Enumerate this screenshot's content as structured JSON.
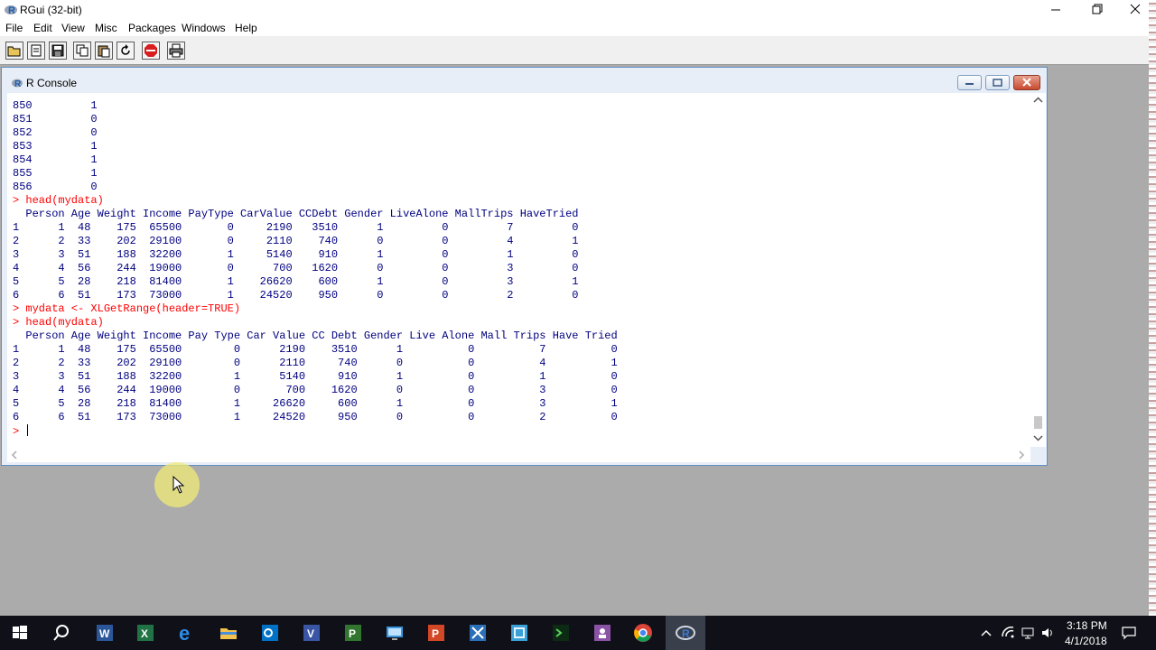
{
  "app": {
    "title": "RGui (32-bit)",
    "menu": [
      "File",
      "Edit",
      "View",
      "Misc",
      "Packages",
      "Windows",
      "Help"
    ],
    "toolbar_buttons": [
      "open-script-icon",
      "load-workspace-icon",
      "save-icon",
      "copy-icon",
      "paste-icon",
      "refresh-icon",
      "stop-icon",
      "print-icon"
    ]
  },
  "console": {
    "title": "R Console",
    "lines": [
      {
        "text": "850         1",
        "type": "out"
      },
      {
        "text": "851         0",
        "type": "out"
      },
      {
        "text": "852         0",
        "type": "out"
      },
      {
        "text": "853         1",
        "type": "out"
      },
      {
        "text": "854         1",
        "type": "out"
      },
      {
        "text": "855         1",
        "type": "out"
      },
      {
        "text": "856         0",
        "type": "out"
      },
      {
        "text": "> head(mydata)",
        "type": "cmd"
      },
      {
        "text": "  Person Age Weight Income PayType CarValue CCDebt Gender LiveAlone MallTrips HaveTried",
        "type": "out"
      },
      {
        "text": "1      1  48    175  65500       0     2190   3510      1         0         7         0",
        "type": "out"
      },
      {
        "text": "2      2  33    202  29100       0     2110    740      0         0         4         1",
        "type": "out"
      },
      {
        "text": "3      3  51    188  32200       1     5140    910      1         0         1         0",
        "type": "out"
      },
      {
        "text": "4      4  56    244  19000       0      700   1620      0         0         3         0",
        "type": "out"
      },
      {
        "text": "5      5  28    218  81400       1    26620    600      1         0         3         1",
        "type": "out"
      },
      {
        "text": "6      6  51    173  73000       1    24520    950      0         0         2         0",
        "type": "out"
      },
      {
        "text": "> mydata <- XLGetRange(header=TRUE)",
        "type": "cmd"
      },
      {
        "text": "> head(mydata)",
        "type": "cmd"
      },
      {
        "text": "  Person Age Weight Income Pay Type Car Value CC Debt Gender Live Alone Mall Trips Have Tried",
        "type": "out"
      },
      {
        "text": "1      1  48    175  65500        0      2190    3510      1          0          7          0",
        "type": "out"
      },
      {
        "text": "2      2  33    202  29100        0      2110     740      0          0          4          1",
        "type": "out"
      },
      {
        "text": "3      3  51    188  32200        1      5140     910      1          0          1          0",
        "type": "out"
      },
      {
        "text": "4      4  56    244  19000        0       700    1620      0          0          3          0",
        "type": "out"
      },
      {
        "text": "5      5  28    218  81400        1     26620     600      1          0          3          1",
        "type": "out"
      },
      {
        "text": "6      6  51    173  73000        1     24520     950      0          0          2          0",
        "type": "out"
      }
    ],
    "prompt": "> "
  },
  "taskbar": {
    "apps": [
      "start-icon",
      "search-icon",
      "word-icon",
      "excel-icon",
      "edge-icon",
      "file-explorer-icon",
      "outlook-icon",
      "visio-icon",
      "project-icon",
      "network-icon",
      "powerpoint-icon",
      "snipping-tool-icon",
      "control-panel-icon",
      "terminal-icon",
      "teams-icon",
      "chrome-icon",
      "r-gui-icon"
    ],
    "time": "3:18 PM",
    "date": "4/1/2018"
  },
  "colors": {
    "console_output": "#000080",
    "console_command": "#ff0000",
    "console_frame": "#e8eef7",
    "taskbar": "#101018"
  }
}
